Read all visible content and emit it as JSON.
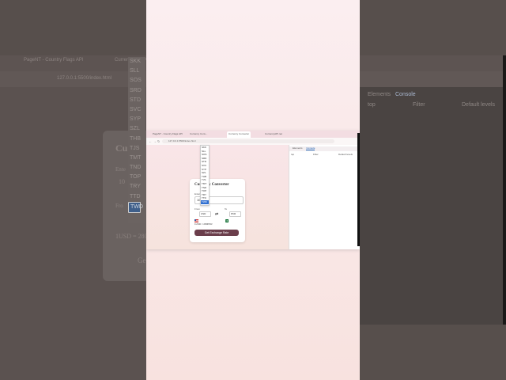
{
  "background": {
    "tab_labels": [
      "PageNT - Country Flags API",
      "Currency Converter"
    ],
    "url": "127.0.0.1:5500/index.html",
    "currency_list": [
      "SKK",
      "SLL",
      "SOS",
      "SRD",
      "STD",
      "SVC",
      "SYP",
      "SZL",
      "THB",
      "TJS",
      "TMT",
      "TND",
      "TOP",
      "TRY",
      "TTD",
      "TWD"
    ],
    "selected_currency": "TWD",
    "title_fragment": "Cu",
    "amount_fragment": "Ente",
    "value_fragment": "10",
    "from_fragment": "Fro",
    "rate_fragment": "1USD = 280",
    "button_fragment": "Ge",
    "devtools_tabs": [
      "Elements",
      "Console"
    ],
    "devtools_filter": "Filter",
    "devtools_levels": "Default levels",
    "devtools_top": "top"
  },
  "screen": {
    "tabs": [
      "PageNT - Country Flags API",
      "Currency Conv...",
      "Currency Converter",
      "CurrencyAPI.net"
    ],
    "url": "127.0.0.1:5500/index.html",
    "card": {
      "title": "Currency Converter",
      "amount_label": "Enter Amount",
      "amount_value": "100",
      "from_label": "From",
      "from_value": "USD",
      "to_label": "To",
      "to_value": "PKR",
      "swap_icon": "⇄",
      "rate_text": "1USD = 280PKR",
      "button_label": "Get Exchange Rate"
    },
    "dropdown_options": [
      "SKK",
      "SLL",
      "SOS",
      "SRD",
      "STD",
      "SVC",
      "SYP",
      "SZL",
      "THB",
      "TJS",
      "TMT",
      "TND",
      "TOP",
      "TRY",
      "TTD",
      "TWD"
    ],
    "dropdown_selected": "TWD",
    "devtools": {
      "tabs": [
        "Elements",
        "Console"
      ],
      "filter": "Filter",
      "levels": "Default levels",
      "context": "top"
    }
  }
}
